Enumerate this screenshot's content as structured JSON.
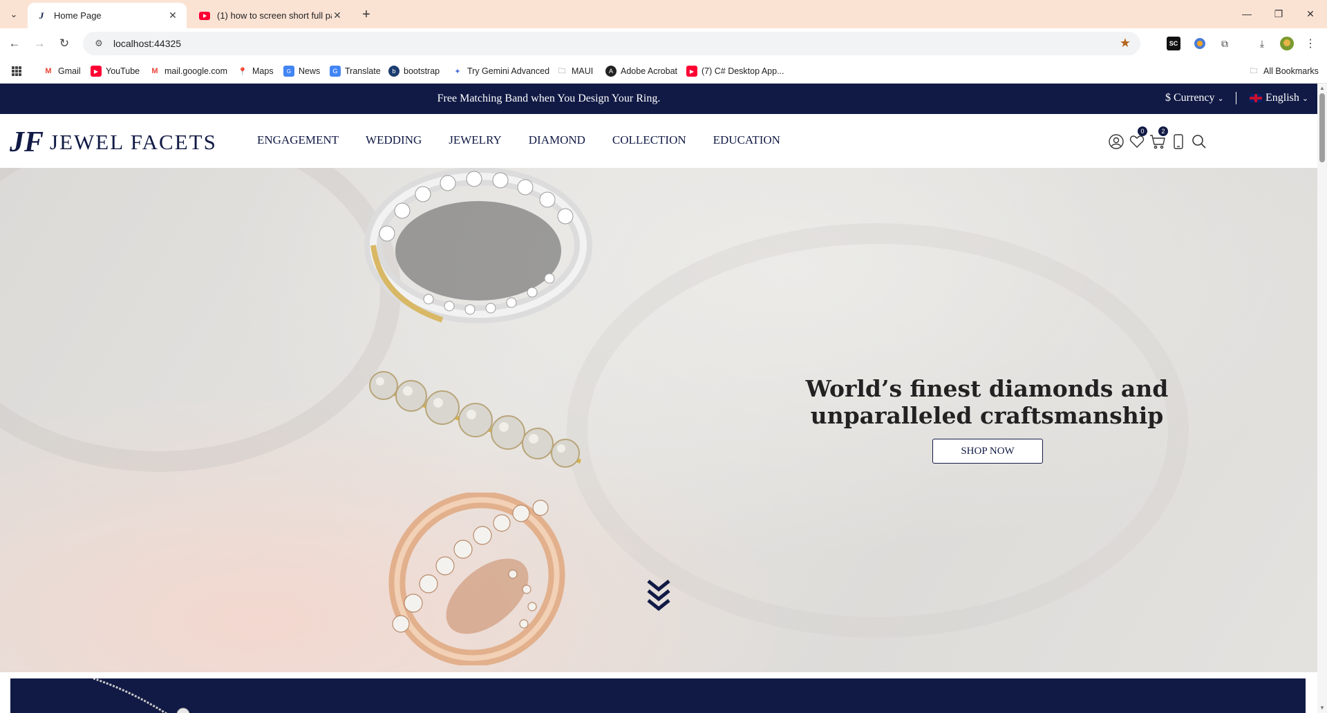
{
  "browser": {
    "tabs": [
      {
        "title": "Home Page",
        "active": true
      },
      {
        "title": "(1) how to screen short full pag",
        "active": false
      }
    ],
    "url": "localhost:44325",
    "bookmarks": [
      {
        "label": "Gmail",
        "icon": "gmail-icon"
      },
      {
        "label": "YouTube",
        "icon": "youtube-icon"
      },
      {
        "label": "mail.google.com",
        "icon": "gmail-icon"
      },
      {
        "label": "Maps",
        "icon": "maps-icon"
      },
      {
        "label": "News",
        "icon": "news-icon"
      },
      {
        "label": "Translate",
        "icon": "translate-icon"
      },
      {
        "label": "bootstrap",
        "icon": "bootstrap-icon"
      },
      {
        "label": "Try Gemini Advanced",
        "icon": "gemini-icon"
      },
      {
        "label": "MAUI",
        "icon": "folder-icon"
      },
      {
        "label": "Adobe Acrobat",
        "icon": "acrobat-icon"
      },
      {
        "label": "(7) C# Desktop App...",
        "icon": "youtube-icon"
      }
    ],
    "all_bookmarks": "All Bookmarks"
  },
  "promo": {
    "text": "Free Matching Band when You Design Your Ring.",
    "currency": "$ Currency",
    "language": "English"
  },
  "header": {
    "logo_mark": "JF",
    "logo_text": "JEWEL FACETS",
    "nav": [
      "ENGAGEMENT",
      "WEDDING",
      "JEWELRY",
      "DIAMOND",
      "COLLECTION",
      "EDUCATION"
    ],
    "wishlist_count": "0",
    "cart_count": "2"
  },
  "hero": {
    "heading_line1": "World’s finest diamonds and",
    "heading_line2": "unparalleled craftsmanship",
    "cta": "SHOP NOW"
  },
  "colors": {
    "brand_navy": "#111a45",
    "tabbar": "#fbe3d4"
  }
}
